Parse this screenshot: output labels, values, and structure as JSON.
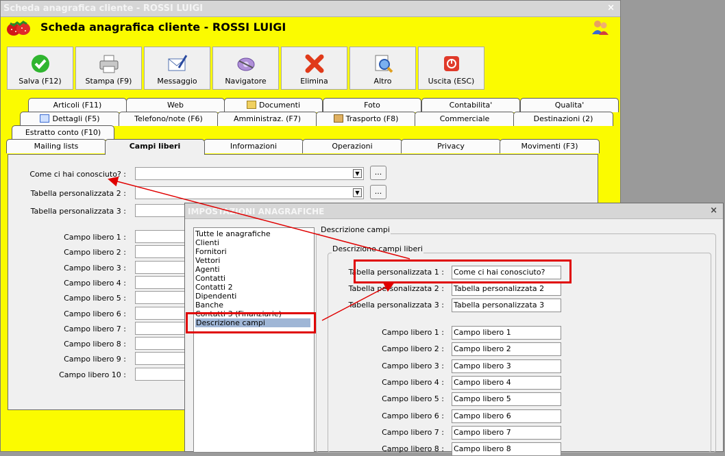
{
  "window": {
    "title": "Scheda anagrafica cliente - ROSSI LUIGI",
    "close": "×",
    "header_title": "Scheda anagrafica cliente - ROSSI LUIGI"
  },
  "toolbar": [
    {
      "label": "Salva (F12)",
      "icon": "check-icon"
    },
    {
      "label": "Stampa (F9)",
      "icon": "printer-icon"
    },
    {
      "label": "Messaggio",
      "icon": "message-icon"
    },
    {
      "label": "Navigatore",
      "icon": "navigator-icon"
    },
    {
      "label": "Elimina",
      "icon": "delete-icon"
    },
    {
      "label": "Altro",
      "icon": "search-doc-icon"
    },
    {
      "label": "Uscita (ESC)",
      "icon": "exit-icon"
    }
  ],
  "tabs_row1": [
    "Articoli (F11)",
    "Web",
    "Documenti",
    "Foto",
    "Contabilita'",
    "Qualita'"
  ],
  "tabs_row2": [
    "Dettagli (F5)",
    "Telefono/note (F6)",
    "Amministraz. (F7)",
    "Trasporto (F8)",
    "Commerciale",
    "Destinazioni (2)"
  ],
  "tabs_row3": [
    "Estratto conto (F10)"
  ],
  "tabs_row4": [
    "Mailing lists",
    "Campi liberi",
    "Informazioni",
    "Operazioni",
    "Privacy",
    "Movimenti (F3)"
  ],
  "form": {
    "combo_fields": [
      {
        "label": "Come ci hai conosciuto? :",
        "value": ""
      },
      {
        "label": "Tabella personalizzata 2 :",
        "value": ""
      },
      {
        "label": "Tabella personalizzata 3 :",
        "value": ""
      }
    ],
    "free_fields": [
      "Campo libero 1 :",
      "Campo libero 2 :",
      "Campo libero 3 :",
      "Campo libero 4 :",
      "Campo libero 5 :",
      "Campo libero 6 :",
      "Campo libero 7 :",
      "Campo libero 8 :",
      "Campo libero 9 :",
      "Campo libero 10 :"
    ],
    "ellipsis": "..."
  },
  "dialog": {
    "title": "IMPOSTAZIONI ANAGRAFICHE",
    "close": "×",
    "list": [
      "Tutte le anagrafiche",
      "Clienti",
      "Fornitori",
      "Vettori",
      "Agenti",
      "Contatti",
      "Contatti 2",
      "Dipendenti",
      "Banche",
      "Contatti 3 (Finanziarie)",
      "Descrizione campi"
    ],
    "selected": "Descrizione campi",
    "group_outer": "Descrizione campi",
    "group_inner": "Descrizione campi liberi",
    "tables": [
      {
        "label": "Tabella personalizzata 1 :",
        "value": "Come ci hai conosciuto?"
      },
      {
        "label": "Tabella personalizzata 2 :",
        "value": "Tabella personalizzata 2"
      },
      {
        "label": "Tabella personalizzata 3 :",
        "value": "Tabella personalizzata 3"
      }
    ],
    "free": [
      {
        "label": "Campo libero 1 :",
        "value": "Campo libero 1"
      },
      {
        "label": "Campo libero 2 :",
        "value": "Campo libero 2"
      },
      {
        "label": "Campo libero 3 :",
        "value": "Campo libero 3"
      },
      {
        "label": "Campo libero 4 :",
        "value": "Campo libero 4"
      },
      {
        "label": "Campo libero 5 :",
        "value": "Campo libero 5"
      },
      {
        "label": "Campo libero 6 :",
        "value": "Campo libero 6"
      },
      {
        "label": "Campo libero 7 :",
        "value": "Campo libero 7"
      },
      {
        "label": "Campo libero 8 :",
        "value": "Campo libero 8"
      }
    ]
  },
  "colors": {
    "window_bg": "#fbfb00",
    "highlight": "#e00000",
    "selection": "#9fb6d6"
  }
}
